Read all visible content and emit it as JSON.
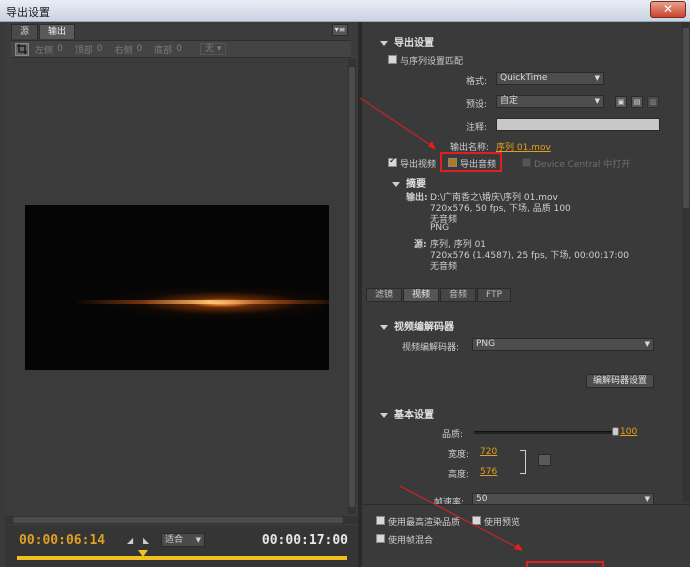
{
  "window": {
    "title": "导出设置",
    "close_glyph": "✕"
  },
  "left_panel": {
    "tabs": [
      "源",
      "输出"
    ],
    "menu_glyph": "▾≡",
    "crop": {
      "labels": [
        "左侧",
        "顶部",
        "右侧",
        "底部"
      ],
      "values": [
        "0",
        "0",
        "0",
        "0"
      ],
      "aspect_value": "无"
    },
    "timecode_current": "00:00:06:14",
    "timecode_total": "00:00:17:00",
    "fit_label": "适合"
  },
  "export_settings": {
    "header": "导出设置",
    "match_sequence_label": "与序列设置匹配",
    "format_label": "格式:",
    "format_value": "QuickTime",
    "preset_label": "预设:",
    "preset_value": "自定",
    "comment_label": "注释:",
    "output_name_label": "输出名称:",
    "output_name_value": "序列 01.mov",
    "export_video_label": "导出视频",
    "export_audio_label": "导出音频",
    "device_central_label": "Device Central 中打开"
  },
  "summary": {
    "header": "摘要",
    "output_label": "输出:",
    "output_lines": [
      "D:\\广南香之\\婚庆\\序列 01.mov",
      "720x576, 50 fps, 下场, 品质 100",
      "无音频",
      "PNG"
    ],
    "source_label": "源:",
    "source_lines": [
      "序列, 序列 01",
      "720x576 (1.4587), 25 fps, 下场, 00:00:17:00",
      "无音频"
    ]
  },
  "subtabs": [
    "滤镜",
    "视频",
    "音频",
    "FTP"
  ],
  "video_codec": {
    "header": "视频编解码器",
    "codec_label": "视频编解码器:",
    "codec_value": "PNG",
    "codec_settings_button": "编解码器设置"
  },
  "basic_settings": {
    "header": "基本设置",
    "quality_label": "品质:",
    "quality_value": "100",
    "quality_fraction": 1.0,
    "width_label": "宽度:",
    "width_value": "720",
    "height_label": "高度:",
    "height_value": "576",
    "frame_rate_label": "帧速率:",
    "frame_rate_value": "50"
  },
  "bottom_options": {
    "max_render_label": "使用最高渲染品质",
    "use_preview_label": "使用预览",
    "frame_blend_label": "使用帧混合"
  },
  "colors": {
    "accent_orange": "#e0a020",
    "highlight_red": "#e02020",
    "panel_bg": "#3a3a3a"
  }
}
